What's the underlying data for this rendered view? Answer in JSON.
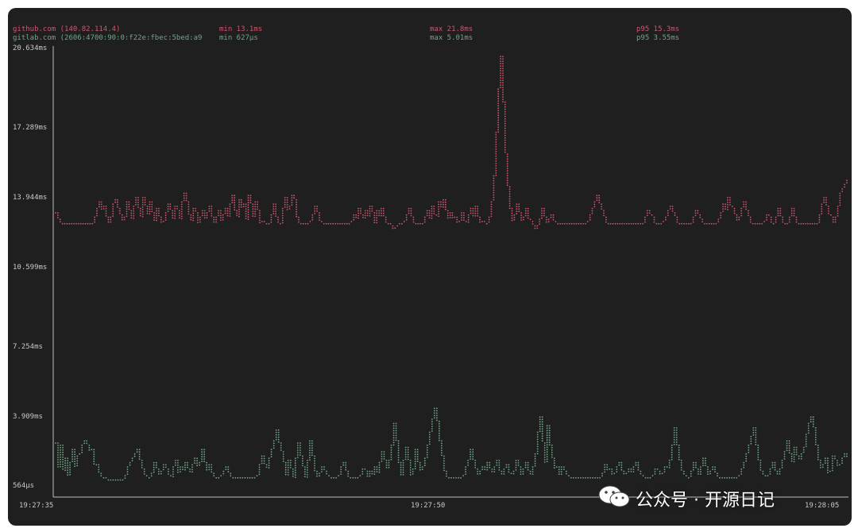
{
  "header": {
    "series1": {
      "host": "github.com (140.82.114.4)",
      "min": "min 13.1ms",
      "max": "max 21.8ms",
      "p95": "p95 15.3ms",
      "color": "#d0566e"
    },
    "series2": {
      "host": "gitlab.com (2606:4700:90:0:f22e:fbec:5bed:a9",
      "min": "min 627µs",
      "max": "max 5.01ms",
      "p95": "p95 3.55ms",
      "color": "#6fa687"
    }
  },
  "watermark": {
    "text": "公众号 · 开源日记",
    "icon": "wechat-icon"
  },
  "chart_data": {
    "type": "line",
    "title": "",
    "xlabel": "",
    "ylabel": "",
    "y_ticks": [
      "20.634ms",
      "17.289ms",
      "13.944ms",
      "10.599ms",
      "7.254ms",
      "3.909ms",
      "564µs"
    ],
    "x_ticks": [
      "19:27:35",
      "19:27:50",
      "19:28:05"
    ],
    "ylim_ms": [
      0.564,
      20.634
    ],
    "style": "dotted braille-like points, dark background",
    "series": [
      {
        "name": "github.com (140.82.114.4)",
        "color": "#d0566e",
        "values_ms": [
          13.1,
          12.8,
          12.6,
          12.6,
          12.6,
          12.6,
          12.6,
          12.6,
          12.6,
          12.6,
          12.6,
          12.6,
          12.6,
          12.6,
          12.6,
          12.6,
          12.6,
          12.9,
          13.3,
          13.6,
          13.2,
          13.4,
          12.9,
          12.6,
          12.9,
          13.5,
          13.7,
          13.3,
          13.0,
          12.7,
          12.9,
          13.6,
          13.2,
          12.8,
          13.4,
          13.8,
          13.3,
          12.9,
          13.8,
          13.4,
          13.0,
          13.6,
          13.1,
          12.7,
          13.3,
          12.9,
          12.6,
          12.7,
          13.1,
          13.5,
          13.2,
          12.8,
          13.4,
          13.2,
          12.8,
          13.6,
          14.0,
          13.6,
          13.0,
          12.7,
          13.3,
          13.1,
          12.6,
          12.9,
          13.2,
          12.8,
          13.1,
          13.4,
          12.9,
          12.6,
          12.9,
          13.2,
          12.7,
          13.0,
          13.3,
          12.9,
          13.5,
          13.9,
          13.2,
          12.9,
          13.7,
          13.3,
          13.5,
          12.8,
          13.9,
          13.5,
          12.9,
          13.6,
          13.2,
          12.6,
          12.7,
          12.6,
          12.6,
          12.6,
          13.0,
          13.5,
          12.9,
          12.6,
          12.6,
          13.3,
          13.8,
          13.2,
          13.4,
          13.9,
          13.7,
          12.9,
          12.6,
          12.6,
          12.6,
          12.6,
          12.6,
          12.7,
          13.0,
          13.4,
          13.1,
          12.7,
          12.6,
          12.6,
          12.6,
          12.6,
          12.6,
          12.6,
          12.6,
          12.6,
          12.6,
          12.6,
          12.6,
          12.6,
          12.6,
          12.7,
          13.0,
          12.8,
          13.3,
          13.0,
          12.8,
          13.2,
          12.9,
          13.4,
          13.1,
          12.6,
          13.2,
          12.9,
          13.3,
          12.9,
          12.6,
          12.6,
          12.5,
          12.3,
          12.4,
          12.5,
          12.6,
          12.6,
          12.7,
          13.0,
          13.3,
          12.9,
          12.6,
          12.6,
          12.6,
          12.6,
          12.6,
          12.9,
          13.2,
          12.8,
          13.4,
          13.0,
          12.9,
          13.6,
          13.3,
          13.7,
          13.2,
          12.8,
          13.1,
          12.8,
          12.9,
          12.6,
          12.7,
          13.1,
          12.7,
          12.6,
          13.0,
          13.3,
          12.9,
          13.4,
          12.9,
          12.6,
          12.7,
          12.6,
          12.6,
          12.9,
          13.6,
          14.8,
          16.8,
          18.8,
          20.3,
          18.2,
          15.8,
          14.3,
          13.3,
          12.7,
          13.0,
          13.5,
          13.1,
          12.7,
          12.9,
          13.3,
          12.8,
          12.7,
          12.5,
          12.3,
          12.5,
          12.8,
          13.3,
          12.9,
          12.6,
          12.8,
          13.0,
          12.7,
          12.6,
          12.6,
          12.6,
          12.6,
          12.6,
          12.6,
          12.6,
          12.6,
          12.6,
          12.6,
          12.6,
          12.6,
          12.6,
          12.6,
          12.7,
          13.0,
          13.3,
          13.6,
          13.9,
          13.5,
          13.2,
          12.9,
          12.6,
          12.6,
          12.6,
          12.6,
          12.6,
          12.6,
          12.6,
          12.6,
          12.6,
          12.6,
          12.6,
          12.6,
          12.6,
          12.6,
          12.6,
          12.6,
          12.6,
          12.9,
          13.2,
          13.0,
          12.9,
          12.6,
          12.6,
          12.6,
          12.6,
          12.7,
          12.9,
          13.2,
          13.4,
          13.1,
          12.9,
          12.6,
          12.6,
          12.6,
          12.6,
          12.6,
          12.6,
          12.6,
          12.9,
          13.2,
          13.0,
          12.8,
          12.6,
          12.6,
          12.6,
          12.6,
          12.6,
          12.6,
          12.6,
          12.8,
          13.1,
          13.5,
          13.2,
          13.8,
          13.4,
          13.3,
          13.0,
          12.7,
          12.9,
          13.3,
          13.6,
          13.2,
          12.9,
          12.6,
          12.6,
          12.6,
          12.6,
          12.6,
          12.6,
          12.7,
          13.0,
          12.9,
          12.6,
          12.6,
          12.9,
          13.3,
          12.9,
          12.6,
          12.6,
          12.6,
          12.9,
          13.3,
          12.9,
          12.6,
          12.6,
          12.6,
          12.6,
          12.6,
          12.6,
          12.6,
          12.6,
          12.6,
          12.6,
          13.0,
          13.5,
          13.8,
          13.4,
          13.0,
          12.9,
          12.6,
          12.9,
          13.4,
          14.0,
          14.2,
          14.4,
          14.6
        ]
      },
      {
        "name": "gitlab.com (2606:4700:90:0:f22e:fbec:5bed:a9",
        "color": "#6fa687",
        "values_ms": [
          2.5,
          1.4,
          2.4,
          1.2,
          1.8,
          1.0,
          1.6,
          2.2,
          1.4,
          1.9,
          2.0,
          2.4,
          2.6,
          2.4,
          2.1,
          2.2,
          1.5,
          1.5,
          1.1,
          0.9,
          0.9,
          0.8,
          0.8,
          0.8,
          0.8,
          0.8,
          0.8,
          0.8,
          0.8,
          1.0,
          1.4,
          1.6,
          1.8,
          2.0,
          2.2,
          1.7,
          1.3,
          1.0,
          0.9,
          0.9,
          1.1,
          1.6,
          1.3,
          1.0,
          1.2,
          1.5,
          1.3,
          1.0,
          0.9,
          1.4,
          1.7,
          1.1,
          1.4,
          1.2,
          1.6,
          1.3,
          1.1,
          1.5,
          1.8,
          1.4,
          1.6,
          2.2,
          1.6,
          1.2,
          1.5,
          1.1,
          0.9,
          0.9,
          0.9,
          1.0,
          1.2,
          1.4,
          1.1,
          0.9,
          0.9,
          0.9,
          0.9,
          0.9,
          0.9,
          0.9,
          0.9,
          0.9,
          0.9,
          0.9,
          1.0,
          1.5,
          1.9,
          1.5,
          1.3,
          1.8,
          2.2,
          2.6,
          3.1,
          2.5,
          2.1,
          1.6,
          1.0,
          1.7,
          1.3,
          0.9,
          1.8,
          2.5,
          1.9,
          1.4,
          0.9,
          1.7,
          2.6,
          1.9,
          1.2,
          0.9,
          1.1,
          1.4,
          1.2,
          1.0,
          0.9,
          0.9,
          0.9,
          0.9,
          1.0,
          1.4,
          1.6,
          1.2,
          0.9,
          0.9,
          0.9,
          0.9,
          0.9,
          1.0,
          1.3,
          1.2,
          0.9,
          1.2,
          1.0,
          1.4,
          1.1,
          1.6,
          2.1,
          1.7,
          1.3,
          1.7,
          2.4,
          3.4,
          2.6,
          1.6,
          1.0,
          1.7,
          2.3,
          1.7,
          1.0,
          1.3,
          2.2,
          1.6,
          1.2,
          1.4,
          1.8,
          2.4,
          3.0,
          3.6,
          4.1,
          3.5,
          2.6,
          1.9,
          1.2,
          0.9,
          0.9,
          0.9,
          0.9,
          0.9,
          0.9,
          0.9,
          1.0,
          1.4,
          1.7,
          2.2,
          1.7,
          1.3,
          1.0,
          1.2,
          1.4,
          1.2,
          1.6,
          1.3,
          1.1,
          1.4,
          1.7,
          1.2,
          1.0,
          1.3,
          1.5,
          1.1,
          1.0,
          1.2,
          1.7,
          1.4,
          1.0,
          1.3,
          1.6,
          1.2,
          1.0,
          1.4,
          2.0,
          3.0,
          3.7,
          2.5,
          1.6,
          3.3,
          2.4,
          1.8,
          1.3,
          1.4,
          1.0,
          1.4,
          1.2,
          1.0,
          0.9,
          0.9,
          0.9,
          0.9,
          0.9,
          0.9,
          0.9,
          0.9,
          0.9,
          0.9,
          0.9,
          0.9,
          0.9,
          0.9,
          1.1,
          1.5,
          1.2,
          1.3,
          1.0,
          1.1,
          1.4,
          1.6,
          1.2,
          1.0,
          1.1,
          1.3,
          1.1,
          1.4,
          1.6,
          1.2,
          1.0,
          0.9,
          0.9,
          0.9,
          0.9,
          1.0,
          1.3,
          1.2,
          1.0,
          1.1,
          1.4,
          1.3,
          1.7,
          2.4,
          3.2,
          2.4,
          1.7,
          1.2,
          1.0,
          0.9,
          0.9,
          1.2,
          1.6,
          1.3,
          1.0,
          1.4,
          1.8,
          1.4,
          1.0,
          1.2,
          1.4,
          1.1,
          0.9,
          0.9,
          0.9,
          0.9,
          0.9,
          0.9,
          0.9,
          0.9,
          0.9,
          1.0,
          1.3,
          1.6,
          2.0,
          2.4,
          2.8,
          3.2,
          2.4,
          1.7,
          1.2,
          1.0,
          0.9,
          1.0,
          1.3,
          1.6,
          1.2,
          1.0,
          1.3,
          1.7,
          2.1,
          2.6,
          2.0,
          1.6,
          2.3,
          1.9,
          1.7,
          2.0,
          2.3,
          2.9,
          3.4,
          3.7,
          3.2,
          2.4,
          1.7,
          1.3,
          1.5,
          1.8,
          1.1,
          1.2,
          1.9,
          1.7,
          1.4,
          1.5,
          1.8,
          2.0,
          1.8
        ]
      }
    ]
  }
}
